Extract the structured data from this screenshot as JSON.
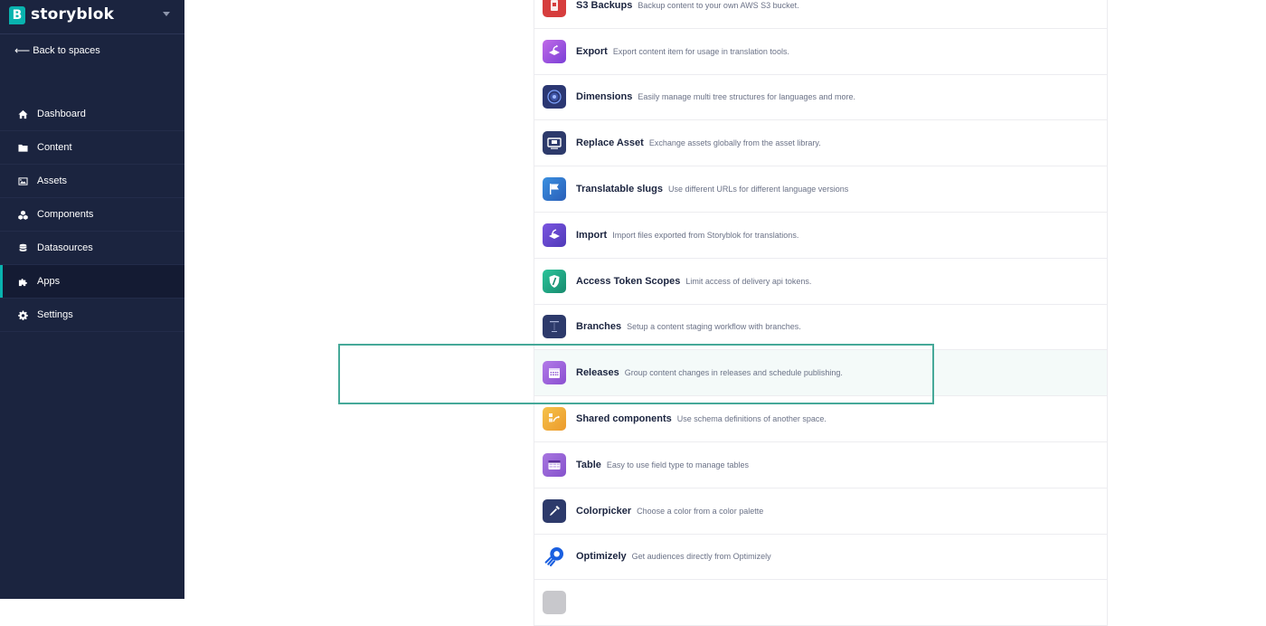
{
  "brand": {
    "logo_letter": "B",
    "name": "storyblok"
  },
  "sidebar": {
    "back_label": "Back to spaces",
    "items": [
      {
        "label": "Dashboard",
        "icon": "home-icon"
      },
      {
        "label": "Content",
        "icon": "folder-icon"
      },
      {
        "label": "Assets",
        "icon": "image-icon"
      },
      {
        "label": "Components",
        "icon": "cubes-icon"
      },
      {
        "label": "Datasources",
        "icon": "database-icon"
      },
      {
        "label": "Apps",
        "icon": "puzzle-icon",
        "active": true
      },
      {
        "label": "Settings",
        "icon": "gear-icon"
      }
    ]
  },
  "apps": [
    {
      "name": "S3 Backups",
      "description": "Backup content to your own AWS S3 bucket.",
      "icon": "s3-backups-icon",
      "color": "#d63d3d"
    },
    {
      "name": "Export",
      "description": "Export content item for usage in translation tools.",
      "icon": "export-icon",
      "color": "#a24cd6"
    },
    {
      "name": "Dimensions",
      "description": "Easily manage multi tree structures for languages and more.",
      "icon": "dimensions-icon",
      "color": "#2b3772"
    },
    {
      "name": "Replace Asset",
      "description": "Exchange assets globally from the asset library.",
      "icon": "replace-asset-icon",
      "color": "#2d3a6b"
    },
    {
      "name": "Translatable slugs",
      "description": "Use different URLs for different language versions",
      "icon": "translatable-slugs-icon",
      "color": "#3a7fd8"
    },
    {
      "name": "Import",
      "description": "Import files exported from Storyblok for translations.",
      "icon": "import-icon",
      "color": "#6a48d0"
    },
    {
      "name": "Access Token Scopes",
      "description": "Limit access of delivery api tokens.",
      "icon": "access-token-icon",
      "color": "#1ea882"
    },
    {
      "name": "Branches",
      "description": "Setup a content staging workflow with branches.",
      "icon": "branches-icon",
      "color": "#2d3a6b"
    },
    {
      "name": "Releases",
      "description": "Group content changes in releases and schedule publishing.",
      "icon": "releases-icon",
      "color": "#9b5fd9",
      "highlighted": true
    },
    {
      "name": "Shared components",
      "description": "Use schema definitions of another space.",
      "icon": "shared-components-icon",
      "color": "#f2b23a"
    },
    {
      "name": "Table",
      "description": "Easy to use field type to manage tables",
      "icon": "table-icon",
      "color": "#9b5fd9"
    },
    {
      "name": "Colorpicker",
      "description": "Choose a color from a color palette",
      "icon": "colorpicker-icon",
      "color": "#2d3a6b"
    },
    {
      "name": "Optimizely",
      "description": "Get audiences directly from Optimizely",
      "icon": "optimizely-icon",
      "color": "#1a5fe0"
    },
    {
      "name": "",
      "description": "",
      "icon": "app-icon",
      "color": "#c8c8cc"
    }
  ]
}
